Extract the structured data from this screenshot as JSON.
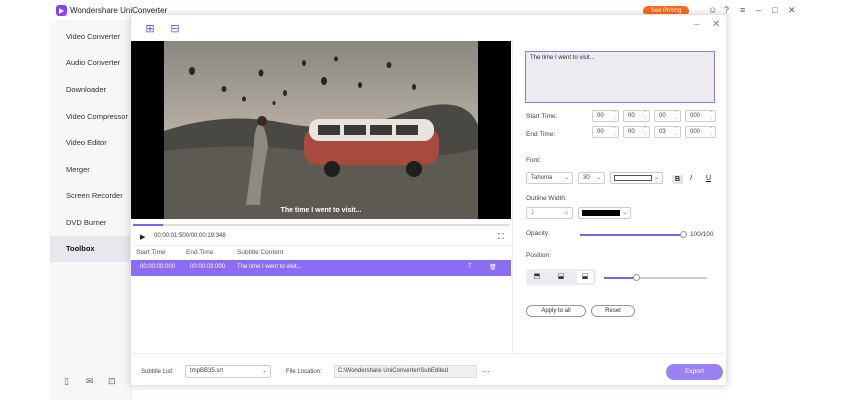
{
  "app": {
    "title": "Wondershare UniConverter",
    "see_pricing": "See Pricing"
  },
  "sidebar": {
    "items": [
      {
        "label": "Video Converter"
      },
      {
        "label": "Audio Converter"
      },
      {
        "label": "Downloader"
      },
      {
        "label": "Video Compressor"
      },
      {
        "label": "Video Editor"
      },
      {
        "label": "Merger"
      },
      {
        "label": "Screen Recorder"
      },
      {
        "label": "DVD Burner"
      },
      {
        "label": "Toolbox",
        "active": true
      }
    ]
  },
  "player": {
    "overlay_subtitle": "The time I went to visit...",
    "timecode": "00:00:01:500/00:00:19:348",
    "progress": 0.08
  },
  "subtitle_table": {
    "headers": [
      "Start Time",
      "End Time",
      "Subtitle Content"
    ],
    "rows": [
      {
        "start": "00:00:00:000",
        "end": "00:00:03:000",
        "content": "The time I went to visit..."
      }
    ]
  },
  "editor": {
    "text": "The time I went to visit...",
    "start_time_label": "Start Time:",
    "end_time_label": "End Time:",
    "start_time": [
      "00",
      "00",
      "00",
      "000"
    ],
    "end_time": [
      "00",
      "00",
      "03",
      "000"
    ],
    "font_label": "Font:",
    "font_name": "Tahoma",
    "font_size": "30",
    "font_color": "#ffffff",
    "bold": "B",
    "italic": "I",
    "underline": "U",
    "outline_width_label": "Outline Width:",
    "outline_width": "1",
    "outline_color": "#000000",
    "opacity_label": "Opacity:",
    "opacity_value": "100/100",
    "opacity": 1.0,
    "position_label": "Position:",
    "position_selected": "bottom",
    "apply_to_all": "Apply to all",
    "reset": "Reset"
  },
  "footer": {
    "subtitle_list_label": "Subtitle List:",
    "subtitle_list_value": "tmpBB35.srt",
    "file_location_label": "File Location:",
    "file_location_value": "C:\\Wondershare UniConverter\\SubEdited",
    "more": "···",
    "export": "Export"
  },
  "colors": {
    "accent": "#7b61ff",
    "row_highlight": "#8b6cf4",
    "export_button": "#9a82f3",
    "pricing": "#ff6a1a"
  }
}
